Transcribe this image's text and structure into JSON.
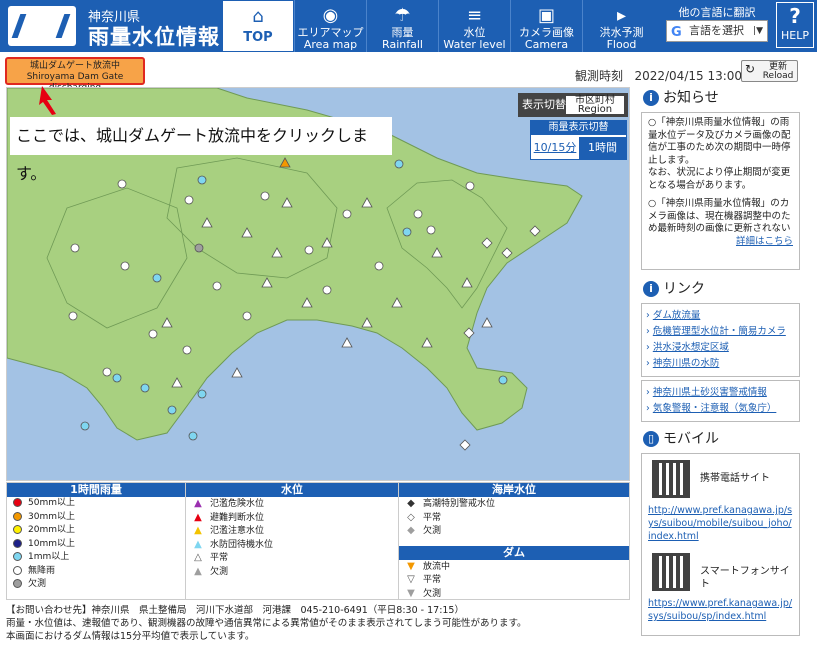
{
  "header": {
    "pref_name": "神奈川県",
    "site_title": "雨量水位情報",
    "nav": [
      {
        "l1": "TOP",
        "l2": "",
        "icon": "home-icon"
      },
      {
        "l1": "エリアマップ",
        "l2": "Area map",
        "icon": "map-pin-icon"
      },
      {
        "l1": "雨量",
        "l2": "Rainfall",
        "icon": "umbrella-icon"
      },
      {
        "l1": "水位",
        "l2": "Water level",
        "icon": "water-level-icon"
      },
      {
        "l1": "カメラ画像",
        "l2": "Camera image",
        "icon": "camera-icon"
      },
      {
        "l1": "洪水予測",
        "l2": "Flood forecast",
        "icon": "megaphone-icon"
      }
    ],
    "lang_title": "他の言語に翻訳",
    "lang_select": "言語を選択",
    "help": "HELP"
  },
  "toolbar": {
    "dam_line1": "城山ダムゲート放流中",
    "dam_line2": "Shiroyama Dam Gate discharging",
    "obs_label": "観測時刻",
    "obs_time": "2022/04/15 13:00",
    "refresh_1": "更新",
    "refresh_2": "Reload"
  },
  "map": {
    "display_label": "表示切替",
    "display_1": "市区町村",
    "display_2": "Region",
    "rain_label": "雨量表示切替",
    "rain_opt1": "10/15分",
    "rain_opt2": "1時間",
    "callout": "ここでは、城山ダムゲート放流中をクリックします。"
  },
  "legend": {
    "rain_head": "1時間雨量",
    "rain": [
      {
        "label": "50mm以上",
        "color": "#e60012"
      },
      {
        "label": "30mm以上",
        "color": "#f39800"
      },
      {
        "label": "20mm以上",
        "color": "#fff100"
      },
      {
        "label": "10mm以上",
        "color": "#1d2088"
      },
      {
        "label": "1mm以上",
        "color": "#7fd6f0"
      },
      {
        "label": "無降雨",
        "color": "#ffffff"
      },
      {
        "label": "欠測",
        "color": "#9e9e9e"
      }
    ],
    "water_head": "水位",
    "water": [
      {
        "label": "氾濫危険水位",
        "color": "#9b30b0"
      },
      {
        "label": "避難判断水位",
        "color": "#e60012"
      },
      {
        "label": "氾濫注意水位",
        "color": "#f3c300"
      },
      {
        "label": "水防団待機水位",
        "color": "#7fd6f0"
      },
      {
        "label": "平常",
        "color": "#ffffff"
      },
      {
        "label": "欠測",
        "color": "#9e9e9e"
      }
    ],
    "coast_head": "海岸水位",
    "coast": [
      {
        "label": "高潮特別警戒水位",
        "color": "#333333"
      },
      {
        "label": "平常",
        "color": "#ffffff"
      },
      {
        "label": "欠測",
        "color": "#9e9e9e"
      }
    ],
    "dam_head": "ダム",
    "dam": [
      {
        "label": "放流中",
        "color": "#f39800"
      },
      {
        "label": "平常",
        "color": "#ffffff"
      },
      {
        "label": "欠測",
        "color": "#9e9e9e"
      }
    ]
  },
  "footer": {
    "line1": "【お問い合わせ先】神奈川県　県土整備局　河川下水道部　河港課　045-210-6491（平日8:30 - 17:15）",
    "line2": "雨量・水位値は、速報値であり、観測機器の故障や通信異常による異常値がそのまま表示されてしまう可能性があります。",
    "line3": "本画面におけるダム情報は15分平均値で表示しています。"
  },
  "side": {
    "notice_head": "お知らせ",
    "notice_1": "○「神奈川県雨量水位情報」の雨量水位データ及びカメラ画像の配信が工事のため次の期間中一時停止します。",
    "notice_2": "なお、状況により停止期間が変更となる場合があります。",
    "notice_3": "○「神奈川県雨量水位情報」のカメラ画像は、現在機器調整中のため最新時刻の画像に更新されない",
    "notice_more": "詳細はこちら",
    "link_head": "リンク",
    "links_a": [
      "ダム放流量",
      "危機管理型水位計・簡易カメラ",
      "洪水浸水想定区域",
      "神奈川県の水防"
    ],
    "links_b": [
      "神奈川県土砂災害警戒情報",
      "気象警報・注意報（気象庁）"
    ],
    "mobile_head": "モバイル",
    "mobile_label_1": "携帯電話サイト",
    "mobile_url_1": " http://www.pref.kanagawa.jp/sys/suibou/mobile/suibou_joho/index.html",
    "mobile_label_2": "スマートフォンサイト",
    "mobile_url_2": " https://www.pref.kanagawa.jp/sys/suibou/sp/index.html"
  }
}
